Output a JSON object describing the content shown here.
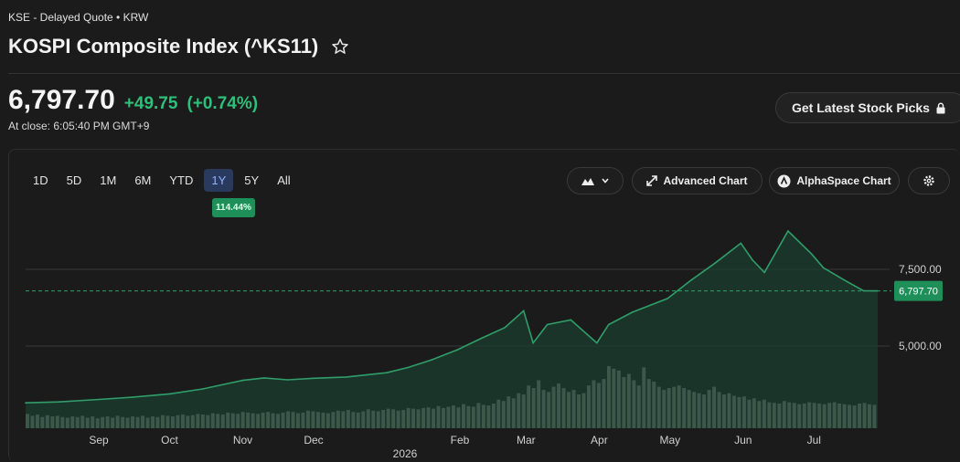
{
  "header": {
    "exchange_line": "KSE - Delayed Quote • KRW",
    "title": "KOSPI Composite Index (^KS11)"
  },
  "quote": {
    "price": "6,797.70",
    "change": "+49.75",
    "change_pct": "(+0.74%)",
    "close_time": "At close: 6:05:40 PM GMT+9"
  },
  "cta": {
    "label": "Get Latest Stock Picks"
  },
  "toolbar": {
    "ranges": [
      "1D",
      "5D",
      "1M",
      "6M",
      "YTD",
      "1Y",
      "5Y",
      "All"
    ],
    "active_range": "1Y",
    "performance_badge": "114.44%",
    "advanced_chart_label": "Advanced Chart",
    "alphaspace_label": "AlphaSpace Chart"
  },
  "colors": {
    "accent_up": "#2ebf7a",
    "line": "#2f9e6a",
    "area_fill": "#1c3d2e",
    "volume": "#c8c8c8",
    "current_price_badge": "#1f8f5a"
  },
  "chart_data": {
    "type": "area",
    "y_ticks": [
      "7,500.00",
      "5,000.00"
    ],
    "current_price_label": "6,797.70",
    "x_month_labels": [
      "Sep",
      "Oct",
      "Nov",
      "Dec",
      "Feb",
      "Mar",
      "Apr",
      "May",
      "Jun",
      "Jul"
    ],
    "x_year_label": "2026",
    "ylim": [
      3000,
      8500
    ],
    "series": [
      {
        "x": [
          "2025-08-01",
          "2025-08-15",
          "2025-09-01",
          "2025-09-15",
          "2025-10-01",
          "2025-10-15",
          "2025-11-01",
          "2025-11-10",
          "2025-11-20",
          "2025-12-01",
          "2025-12-15",
          "2026-01-01",
          "2026-01-10",
          "2026-01-20",
          "2026-01-31",
          "2026-02-10",
          "2026-02-20",
          "2026-02-28",
          "2026-03-04",
          "2026-03-10",
          "2026-03-20",
          "2026-03-31",
          "2026-04-05",
          "2026-04-15",
          "2026-04-30",
          "2026-05-10",
          "2026-05-20",
          "2026-05-31",
          "2026-06-05",
          "2026-06-10",
          "2026-06-20",
          "2026-06-30",
          "2026-07-05",
          "2026-07-15",
          "2026-07-22",
          "2026-07-28"
        ],
        "y": [
          3150,
          3180,
          3260,
          3330,
          3440,
          3600,
          3880,
          3960,
          3900,
          3950,
          3990,
          4130,
          4300,
          4550,
          4880,
          5250,
          5600,
          6150,
          5100,
          5700,
          5850,
          5100,
          5700,
          6100,
          6550,
          7150,
          7700,
          8350,
          7800,
          7400,
          8750,
          8000,
          7550,
          7100,
          6800,
          6797.7
        ]
      }
    ],
    "volume": [
      18,
      15,
      17,
      13,
      16,
      14,
      15,
      13,
      12,
      14,
      13,
      15,
      12,
      14,
      11,
      13,
      14,
      12,
      15,
      13,
      12,
      14,
      13,
      15,
      12,
      14,
      13,
      16,
      15,
      14,
      16,
      17,
      15,
      16,
      18,
      17,
      16,
      19,
      18,
      17,
      20,
      19,
      18,
      21,
      20,
      19,
      18,
      20,
      21,
      19,
      18,
      20,
      22,
      21,
      19,
      20,
      23,
      22,
      21,
      20,
      19,
      21,
      23,
      22,
      24,
      21,
      20,
      22,
      25,
      23,
      22,
      24,
      26,
      25,
      23,
      24,
      27,
      26,
      25,
      27,
      28,
      26,
      30,
      27,
      29,
      31,
      28,
      33,
      30,
      29,
      35,
      32,
      31,
      34,
      40,
      38,
      45,
      42,
      50,
      48,
      62,
      58,
      70,
      55,
      52,
      60,
      65,
      58,
      52,
      55,
      48,
      50,
      62,
      70,
      66,
      72,
      92,
      88,
      85,
      75,
      80,
      70,
      62,
      90,
      72,
      68,
      60,
      55,
      58,
      60,
      62,
      58,
      55,
      52,
      50,
      48,
      55,
      60,
      52,
      48,
      50,
      46,
      44,
      45,
      40,
      42,
      38,
      40,
      36,
      35,
      34,
      38,
      36,
      35,
      33,
      34,
      36,
      35,
      34,
      33,
      35,
      36,
      34,
      33,
      32,
      31,
      34,
      35,
      33,
      32
    ]
  }
}
